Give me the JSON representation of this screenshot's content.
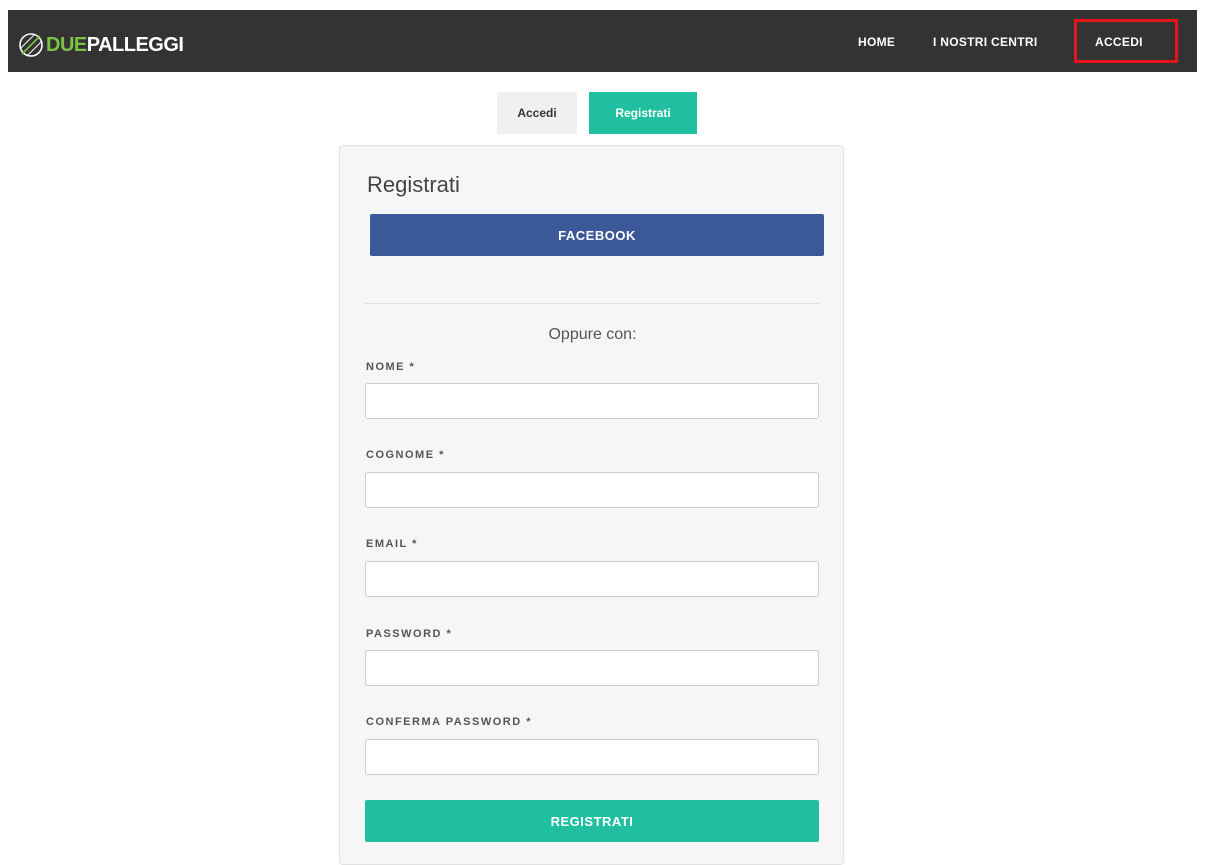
{
  "brand": {
    "logo_part1": "DUE",
    "logo_part2": "PALLEGGI"
  },
  "nav": {
    "home": "HOME",
    "centri": "I NOSTRI CENTRI",
    "accedi": "ACCEDI"
  },
  "tabs": {
    "accedi": "Accedi",
    "registrati": "Registrati"
  },
  "form": {
    "title": "Registrati",
    "facebook_label": "FACEBOOK",
    "oppure": "Oppure con:",
    "fields": {
      "nome": "NOME *",
      "cognome": "COGNOME *",
      "email": "EMAIL *",
      "password": "PASSWORD *",
      "conferma": "CONFERMA PASSWORD *"
    },
    "submit_label": "REGISTRATI"
  },
  "colors": {
    "navbar": "#333333",
    "accent": "#1fbf9f",
    "facebook": "#3b5998",
    "highlight": "#e8141c",
    "logo_green": "#7cc243"
  }
}
